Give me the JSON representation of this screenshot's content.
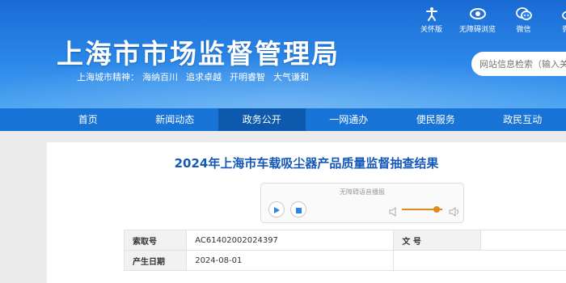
{
  "header": {
    "title": "上海市市场监督管理局",
    "slogan_prefix": "上海城市精神：",
    "slogan_items": [
      "海纳百川",
      "追求卓越",
      "开明睿智",
      "大气谦和"
    ]
  },
  "tools": [
    {
      "label": "关怀版",
      "icon": "accessibility-icon"
    },
    {
      "label": "无障碍浏览",
      "icon": "eye-icon"
    },
    {
      "label": "微信",
      "icon": "wechat-icon"
    },
    {
      "label": "微博",
      "icon": "weibo-icon"
    }
  ],
  "search": {
    "placeholder": "网站信息检索（输入关键字）"
  },
  "nav": {
    "items": [
      "首页",
      "新闻动态",
      "政务公开",
      "一网通办",
      "便民服务",
      "政民互动"
    ],
    "active_index": 2
  },
  "article": {
    "title": "2024年上海市车载吸尘器产品质量监督抽查结果"
  },
  "audio": {
    "caption": "无障碍语音播报",
    "volume_percent": 78
  },
  "meta": {
    "index_label": "索取号",
    "index_value": "AC61402002024397",
    "docno_label": "文 号",
    "docno_value": "",
    "date_label": "产生日期",
    "date_value": "2024-08-01"
  },
  "colors": {
    "header_blue": "#2a86e8",
    "nav_blue": "#1773d6",
    "nav_active": "#0d59ad",
    "title_blue": "#1459b8",
    "volume_orange": "#e08a1e"
  }
}
